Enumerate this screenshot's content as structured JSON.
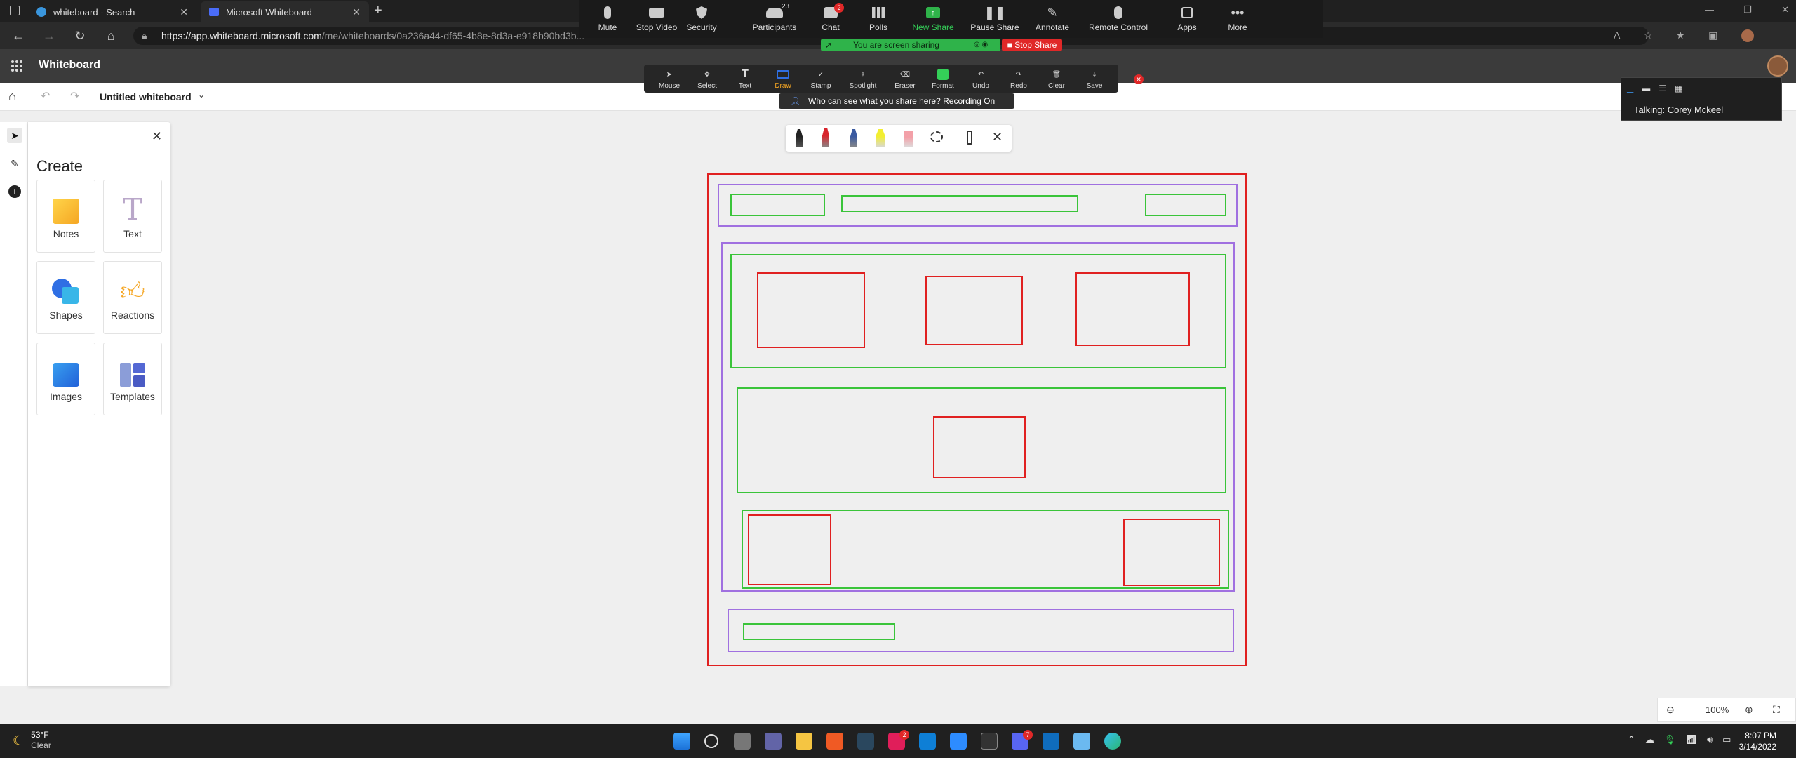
{
  "browser": {
    "tabs": [
      {
        "title": "whiteboard - Search",
        "close": "✕"
      },
      {
        "title": "Microsoft Whiteboard",
        "close": "✕"
      }
    ],
    "new_tab": "+",
    "url_host": "https://app.whiteboard.microsoft.com",
    "url_path": "/me/whiteboards/0a236a44-df65-4b8e-8d3a-e918b90bd3b..."
  },
  "zoom": {
    "buttons": [
      {
        "label": "Mute",
        "icon": "microphone-icon"
      },
      {
        "label": "Stop Video",
        "icon": "camera-icon"
      },
      {
        "label": "Security",
        "icon": "shield-icon"
      },
      {
        "label": "Participants",
        "icon": "people-icon",
        "count": "23"
      },
      {
        "label": "Chat",
        "icon": "chat-icon",
        "badge": "2"
      },
      {
        "label": "Polls",
        "icon": "polls-icon"
      },
      {
        "label": "New Share",
        "icon": "share-icon"
      },
      {
        "label": "Pause Share",
        "icon": "pause-icon"
      },
      {
        "label": "Annotate",
        "icon": "pen-icon"
      },
      {
        "label": "Remote Control",
        "icon": "mouse-icon"
      },
      {
        "label": "Apps",
        "icon": "apps-icon"
      },
      {
        "label": "More",
        "icon": "more-icon"
      }
    ],
    "sharing_status": "You are screen sharing",
    "stop_share": "Stop Share",
    "who_can_see": "Who can see what you share here? Recording On",
    "talking": "Talking: Corey Mckeel"
  },
  "annotate": {
    "tools": [
      "Mouse",
      "Select",
      "Text",
      "Draw",
      "Stamp",
      "Spotlight",
      "Eraser",
      "Format",
      "Undo",
      "Redo",
      "Clear",
      "Save"
    ],
    "active": "Draw"
  },
  "app": {
    "title": "Whiteboard",
    "board_name": "Untitled whiteboard"
  },
  "create_panel": {
    "title": "Create",
    "items": [
      "Notes",
      "Text",
      "Shapes",
      "Reactions",
      "Images",
      "Templates"
    ]
  },
  "zoom_level": "100%",
  "taskbar": {
    "weather_temp": "53°F",
    "weather_desc": "Clear",
    "time": "8:07 PM",
    "date": "3/14/2022",
    "teams_badge": "2",
    "discord_badge": "7"
  },
  "colors": {
    "red": "#e02020",
    "green": "#3ac43a",
    "purple": "#a070e0",
    "zoom_green": "#2fb34a",
    "active_draw": "#f5a623"
  }
}
